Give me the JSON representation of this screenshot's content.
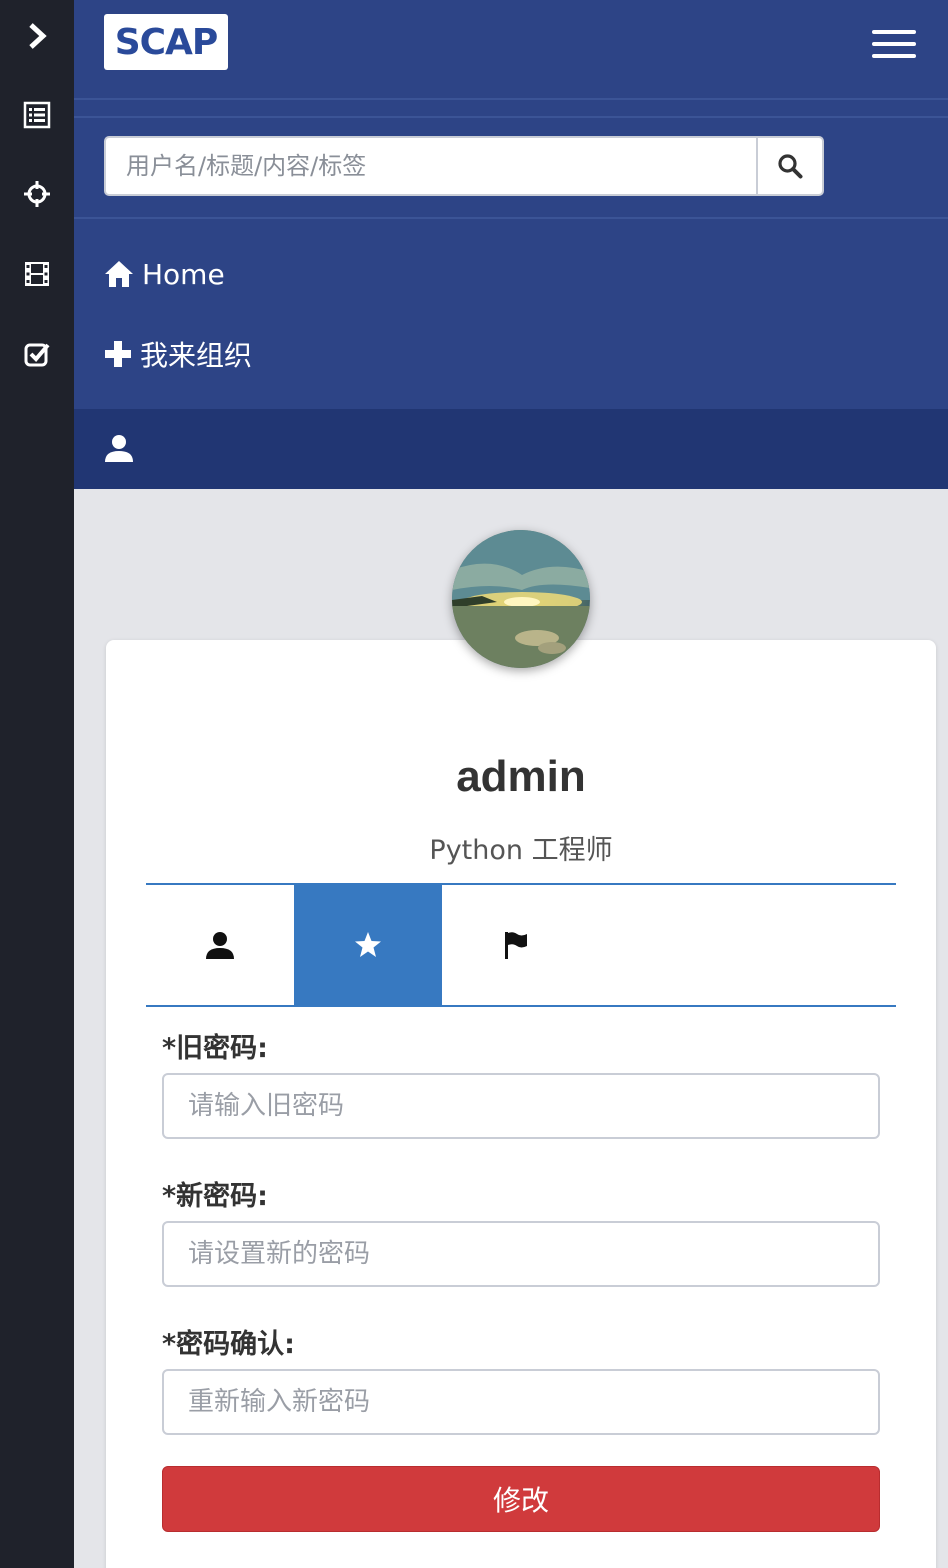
{
  "sidebar": {
    "items": [
      {
        "icon": "chevron-right-icon"
      },
      {
        "icon": "list-icon"
      },
      {
        "icon": "crosshair-icon"
      },
      {
        "icon": "film-icon"
      },
      {
        "icon": "check-square-icon"
      }
    ]
  },
  "header": {
    "logo_text": "SCAP",
    "search_placeholder": "用户名/标题/内容/标签"
  },
  "nav": {
    "home_label": "Home",
    "organize_label": "我来组织"
  },
  "profile": {
    "username": "admin",
    "title": "Python 工程师",
    "tabs": [
      {
        "icon": "user-icon",
        "active": false
      },
      {
        "icon": "star-icon",
        "active": true
      },
      {
        "icon": "flag-icon",
        "active": false
      }
    ]
  },
  "form": {
    "old_password_label": "*旧密码:",
    "old_password_placeholder": "请输入旧密码",
    "new_password_label": "*新密码:",
    "new_password_placeholder": "请设置新的密码",
    "confirm_label": "*密码确认:",
    "confirm_placeholder": "重新输入新密码",
    "submit_label": "修改"
  },
  "colors": {
    "rail": "#1f222b",
    "header": "#2d4486",
    "userbar": "#213673",
    "accent": "#3779c1",
    "danger": "#d03a3c"
  }
}
